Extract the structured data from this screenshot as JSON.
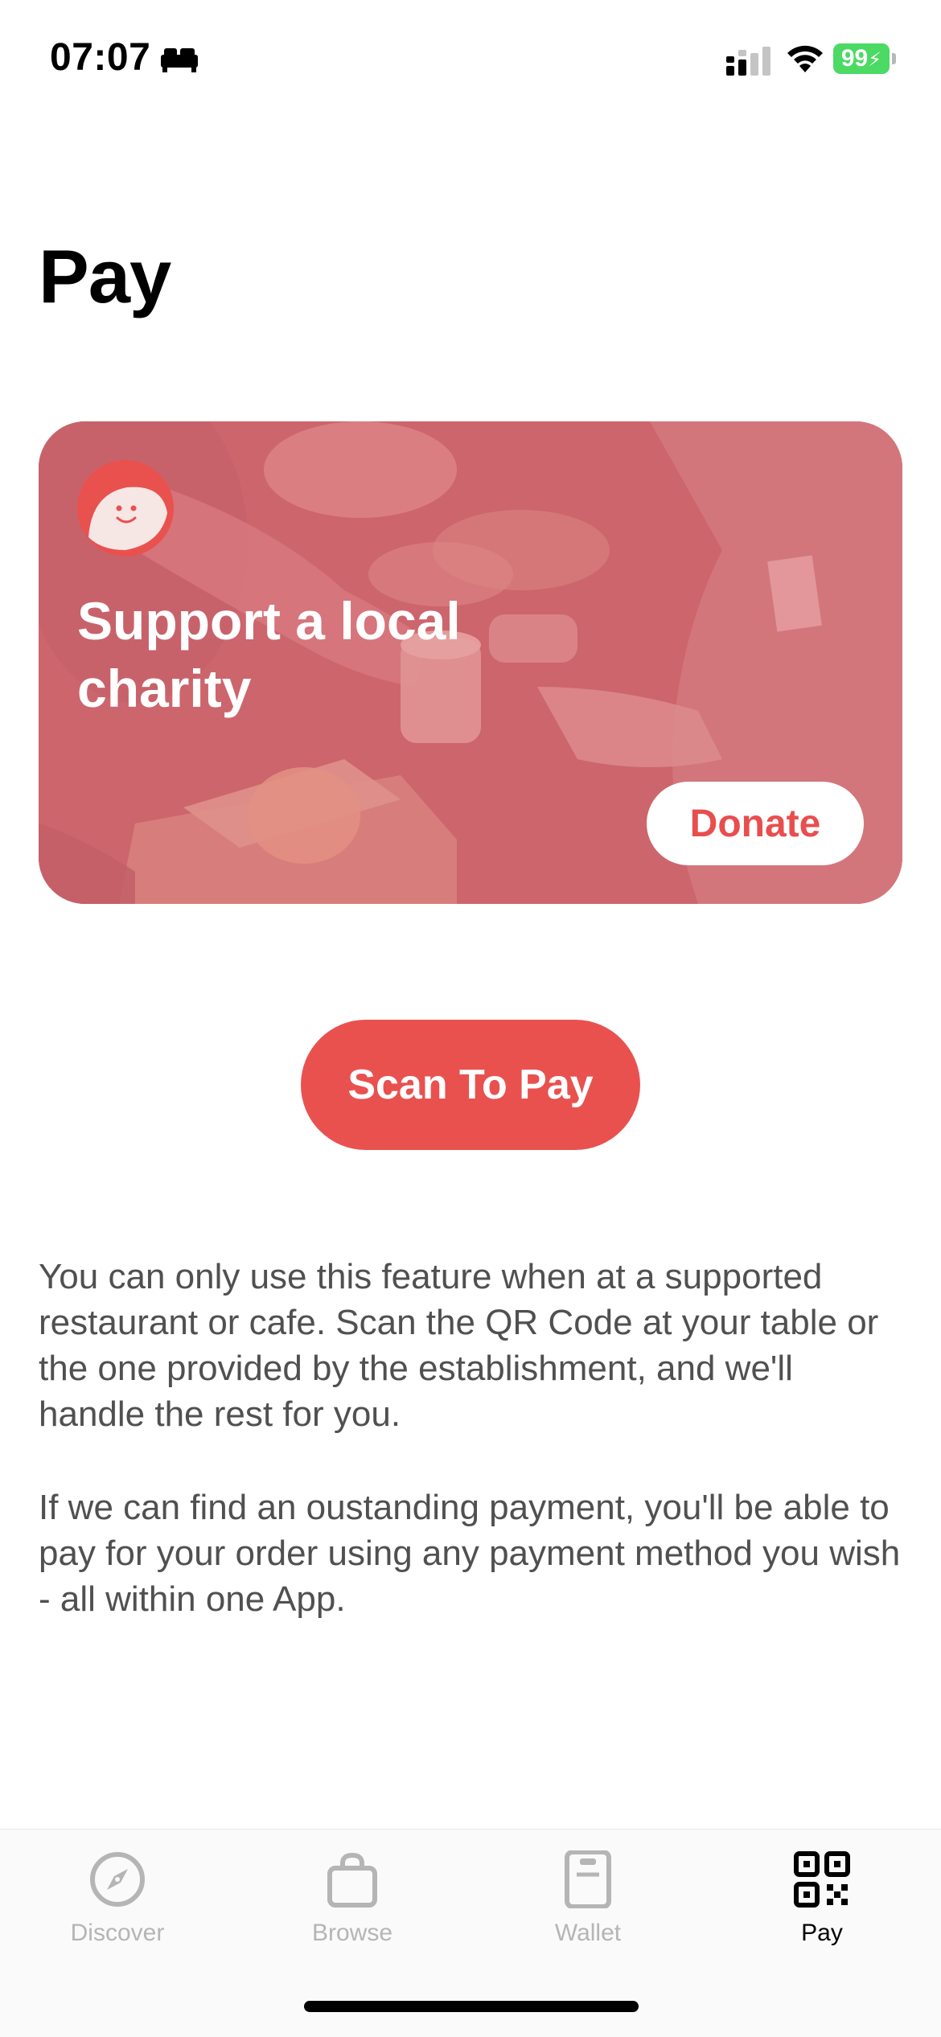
{
  "status_bar": {
    "time": "07:07",
    "battery": "99",
    "icons": [
      "bed-icon",
      "cellular-signal-icon",
      "wifi-icon",
      "battery-charging-icon"
    ]
  },
  "page": {
    "title": "Pay"
  },
  "charity_card": {
    "title": "Support a local charity",
    "donate_label": "Donate",
    "logo_icon": "smiley-logo-icon"
  },
  "scan_button": {
    "label": "Scan To Pay"
  },
  "info": {
    "paragraph_1": "You can only use this feature when at a supported restaurant or cafe. Scan the QR Code at your table or the one provided by the establishment, and we'll handle the rest for you.",
    "paragraph_2": "If we can find an oustanding payment, you'll be able to pay for your order using any payment method you wish - all within one App."
  },
  "tab_bar": {
    "tabs": [
      {
        "label": "Discover",
        "icon": "compass-icon",
        "active": false
      },
      {
        "label": "Browse",
        "icon": "shopping-bag-icon",
        "active": false
      },
      {
        "label": "Wallet",
        "icon": "wallet-icon",
        "active": false
      },
      {
        "label": "Pay",
        "icon": "qr-code-icon",
        "active": true
      }
    ]
  },
  "colors": {
    "accent": "#e9514f",
    "battery": "#4cd964",
    "inactive_tab": "#b5b5b5",
    "body_text": "#505050"
  }
}
